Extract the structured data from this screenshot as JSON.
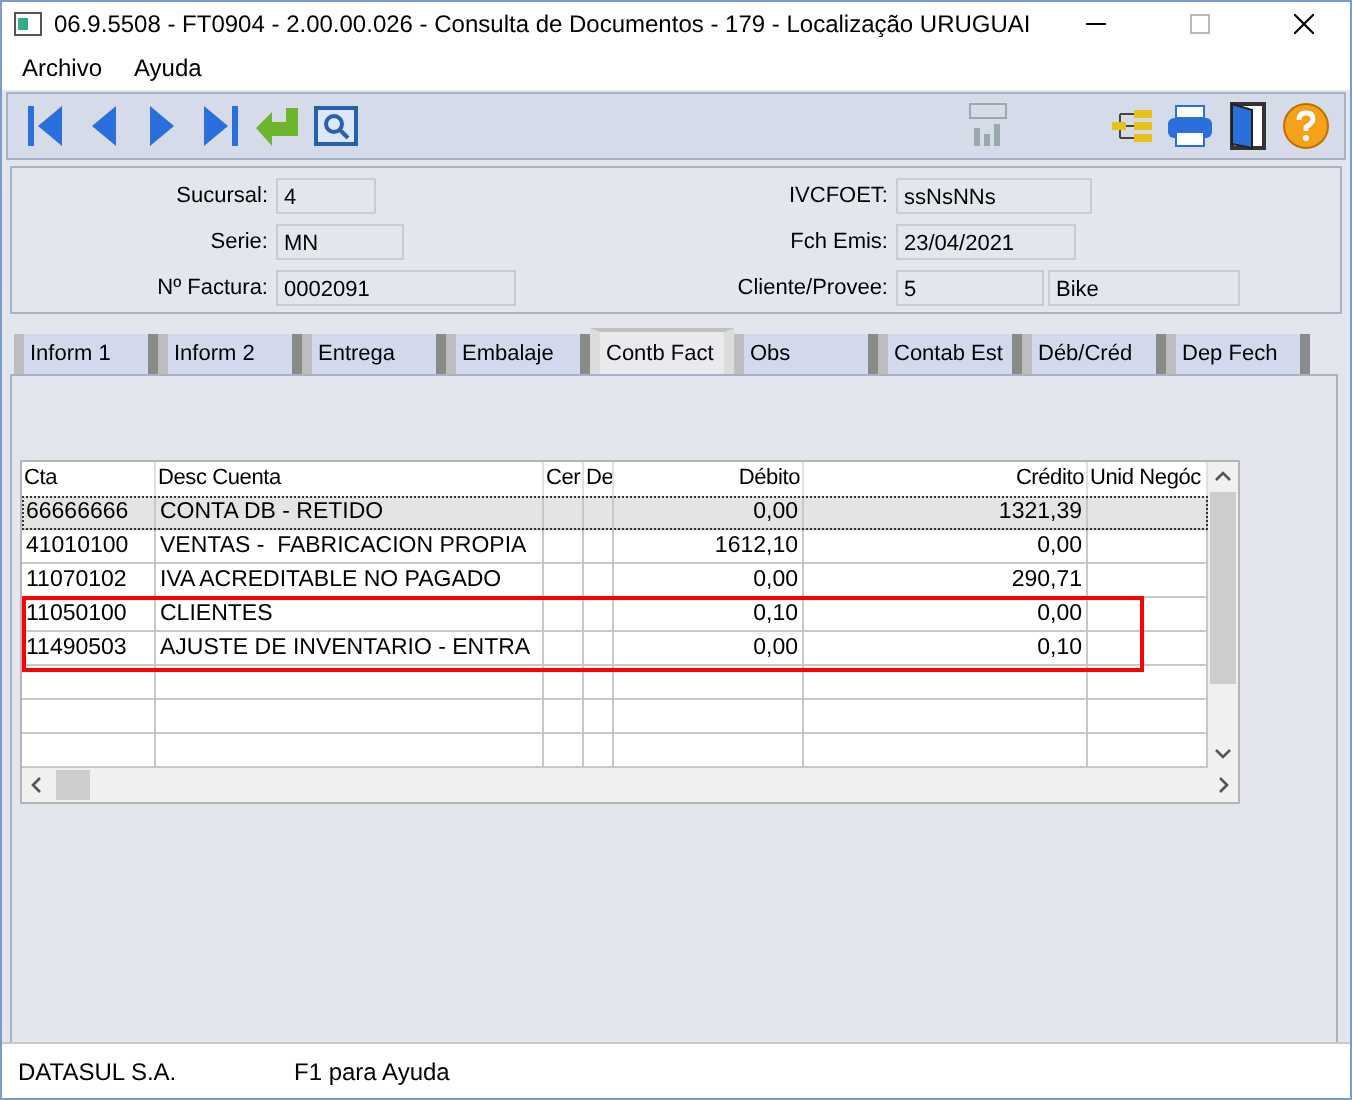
{
  "window": {
    "title": "06.9.5508 - FT0904 - 2.00.00.026 - Consulta de Documentos - 179 - Localização URUGUAI"
  },
  "menu": [
    "Archivo",
    "Ayuda"
  ],
  "header": {
    "left": [
      {
        "label": "Sucursal:",
        "value": "4"
      },
      {
        "label": "Serie:",
        "value": "MN"
      },
      {
        "label": "Nº Factura:",
        "value": "0002091"
      }
    ],
    "right": [
      {
        "label": "IVCFOET:",
        "value": "ssNsNNs"
      },
      {
        "label": "Fch Emis:",
        "value": "23/04/2021"
      },
      {
        "label": "Cliente/Provee:",
        "value": "5",
        "extra": "Bike"
      }
    ]
  },
  "tabs": [
    {
      "label": "Inform 1",
      "selected": false
    },
    {
      "label": "Inform 2",
      "selected": false
    },
    {
      "label": "Entrega",
      "selected": false
    },
    {
      "label": "Embalaje",
      "selected": false
    },
    {
      "label": "Contb Fact",
      "selected": true
    },
    {
      "label": "Obs",
      "selected": false
    },
    {
      "label": "Contab Est",
      "selected": false
    },
    {
      "label": "Déb/Créd",
      "selected": false
    },
    {
      "label": "Dep Fech",
      "selected": false
    }
  ],
  "table": {
    "columns": [
      "Cta",
      "Desc Cuenta",
      "Cer",
      "De",
      "Débito",
      "Crédito",
      "Unid Negóc"
    ],
    "rows": [
      {
        "cells": [
          "66666666",
          "CONTA DB - RETIDO",
          "",
          "",
          "0,00",
          "1321,39",
          ""
        ],
        "selected": true,
        "highlighted": false
      },
      {
        "cells": [
          "41010100",
          "VENTAS -  FABRICACION PROPIA",
          "",
          "",
          "1612,10",
          "0,00",
          ""
        ],
        "selected": false,
        "highlighted": false
      },
      {
        "cells": [
          "11070102",
          "IVA ACREDITABLE NO PAGADO",
          "",
          "",
          "0,00",
          "290,71",
          ""
        ],
        "selected": false,
        "highlighted": false
      },
      {
        "cells": [
          "11050100",
          "CLIENTES",
          "",
          "",
          "0,10",
          "0,00",
          ""
        ],
        "selected": false,
        "highlighted": true
      },
      {
        "cells": [
          "11490503",
          "AJUSTE DE INVENTARIO - ENTRA",
          "",
          "",
          "0,00",
          "0,10",
          ""
        ],
        "selected": false,
        "highlighted": true
      }
    ]
  },
  "status_bar": [
    "DATASUL S.A.",
    "F1 para Ayuda"
  ]
}
